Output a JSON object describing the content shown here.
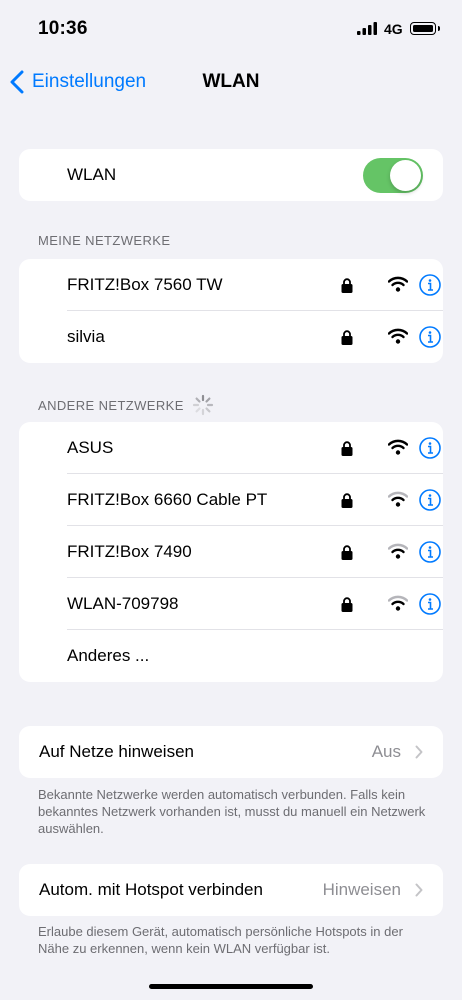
{
  "status": {
    "time": "10:36",
    "network": "4G"
  },
  "nav": {
    "back_label": "Einstellungen",
    "title": "WLAN"
  },
  "wlan_toggle": {
    "label": "WLAN",
    "on": true,
    "accent": "#65c466"
  },
  "my_networks": {
    "header": "MEINE NETZWERKE",
    "items": [
      {
        "name": "FRITZ!Box 7560 TW",
        "locked": true,
        "signal": "full"
      },
      {
        "name": "silvia",
        "locked": true,
        "signal": "full"
      }
    ]
  },
  "other_networks": {
    "header": "ANDERE NETZWERKE",
    "items": [
      {
        "name": "ASUS",
        "locked": true,
        "signal": "full"
      },
      {
        "name": "FRITZ!Box 6660 Cable PT",
        "locked": true,
        "signal": "partial"
      },
      {
        "name": "FRITZ!Box 7490",
        "locked": true,
        "signal": "partial"
      },
      {
        "name": "WLAN-709798",
        "locked": true,
        "signal": "partial"
      }
    ],
    "other_label": "Anderes ..."
  },
  "ask_join": {
    "label": "Auf Netze hinweisen",
    "value": "Aus",
    "footnote": "Bekannte Netzwerke werden automatisch verbunden. Falls kein bekanntes Netzwerk vorhanden ist, musst du manuell ein Netzwerk auswählen."
  },
  "hotspot": {
    "label": "Autom. mit Hotspot verbinden",
    "value": "Hinweisen",
    "footnote": "Erlaube diesem Gerät, automatisch persönliche Hotspots in der Nähe zu erkennen, wenn kein WLAN verfügbar ist."
  },
  "colors": {
    "accent": "#007aff",
    "background": "#f2f2f7",
    "toggle_on": "#65c466"
  }
}
